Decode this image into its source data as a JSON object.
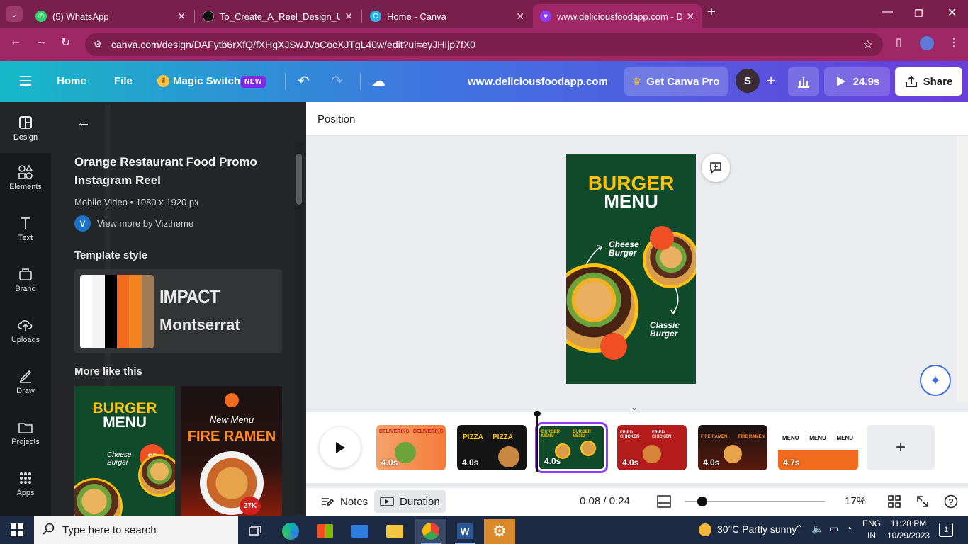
{
  "browser": {
    "tabs": [
      {
        "title": "(5) WhatsApp",
        "favicon": "whatsapp-icon",
        "color": "#25d366"
      },
      {
        "title": "To_Create_A_Reel_Design_Usin",
        "favicon": "github-icon",
        "color": "#222"
      },
      {
        "title": "Home - Canva",
        "favicon": "canva-icon",
        "color": "#2ab3e6"
      },
      {
        "title": "www.deliciousfoodapp.com - D",
        "favicon": "canva-heart-icon",
        "color": "#8b3dff"
      }
    ],
    "active_tab": 3,
    "url": "canva.com/design/DAFytb6rXfQ/fXHgXJSwJVoCocXJTgL40w/edit?ui=eyJHIjp7fX0"
  },
  "header": {
    "home": "Home",
    "file": "File",
    "magic_switch": "Magic Switch",
    "new_badge": "NEW",
    "doc_title": "www.deliciousfoodapp.com",
    "get_pro": "Get Canva Pro",
    "avatar_letter": "S",
    "play_time": "24.9s",
    "share": "Share"
  },
  "rail": {
    "items": [
      {
        "label": "Design",
        "icon": "design-icon"
      },
      {
        "label": "Elements",
        "icon": "elements-icon"
      },
      {
        "label": "Text",
        "icon": "text-icon"
      },
      {
        "label": "Brand",
        "icon": "brand-icon"
      },
      {
        "label": "Uploads",
        "icon": "uploads-icon"
      },
      {
        "label": "Draw",
        "icon": "draw-icon"
      },
      {
        "label": "Projects",
        "icon": "projects-icon"
      },
      {
        "label": "Apps",
        "icon": "apps-icon"
      }
    ]
  },
  "panel": {
    "title": "Orange Restaurant Food Promo Instagram Reel",
    "subtitle": "Mobile Video • 1080 x 1920 px",
    "author_initial": "V",
    "author_link": "View more by Viztheme",
    "template_style_heading": "Template style",
    "font_heading": "IMPACT",
    "font_body": "Montserrat",
    "swatches": [
      "#ffffff",
      "#f4f4f4",
      "#000000",
      "#f26b1d",
      "#f58220",
      "#a07a53"
    ],
    "more_heading": "More like this",
    "thumb1": {
      "line1": "BURGER",
      "line2": "MENU",
      "badge": "$5",
      "script": "Cheese Burger"
    },
    "thumb2": {
      "script": "New Menu",
      "title": "FIRE RAMEN",
      "badge": "27K"
    }
  },
  "toolbar": {
    "position": "Position"
  },
  "canvas": {
    "line1": "BURGER",
    "line2": "MENU",
    "label1a": "Cheese",
    "label1b": "Burger",
    "label2a": "Classic",
    "label2b": "Burger"
  },
  "timeline": {
    "clips": [
      {
        "duration": "4.0s",
        "theme": "orange"
      },
      {
        "duration": "4.0s",
        "theme": "dark-pizza"
      },
      {
        "duration": "4.0s",
        "theme": "green-burger",
        "selected": true
      },
      {
        "duration": "4.0s",
        "theme": "red-chicken"
      },
      {
        "duration": "4.0s",
        "theme": "dark-ramen"
      },
      {
        "duration": "4.7s",
        "theme": "white-menu"
      }
    ],
    "clip_texts": {
      "c1": "DELIVERING",
      "c2": "PIZZA",
      "c3": "BURGER MENU",
      "c4": "FRIED CHICKEN",
      "c5": "FIRE RAMEN",
      "c6": "MENU"
    }
  },
  "footer": {
    "notes": "Notes",
    "duration": "Duration",
    "time": "0:08 / 0:24",
    "zoom": "17%"
  },
  "taskbar": {
    "search_placeholder": "Type here to search",
    "weather": "30°C  Partly sunny",
    "lang1": "ENG",
    "lang2": "IN",
    "time": "11:28 PM",
    "date": "10/29/2023",
    "notifications": "1"
  }
}
